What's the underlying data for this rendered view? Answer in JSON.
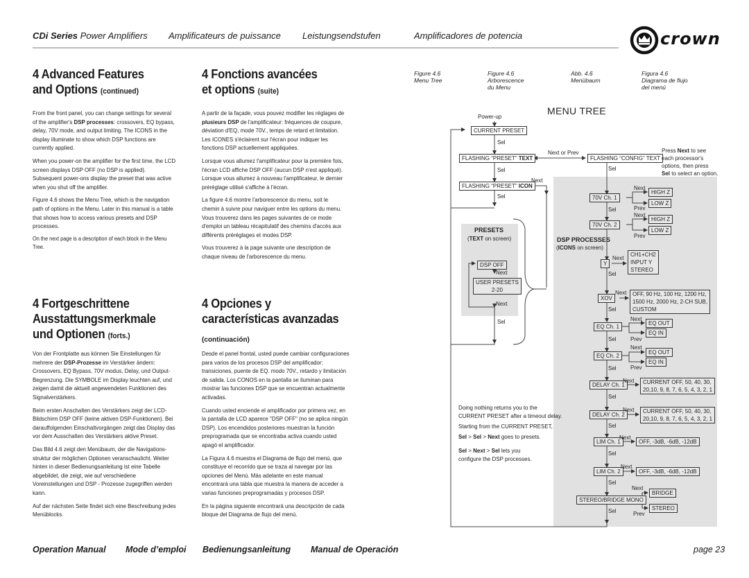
{
  "header": {
    "series_bold": "CDi Series",
    "series_rest": " Power Amplifiers",
    "fr": "Amplificateurs de puissance",
    "de": "Leistungsendstufen",
    "es": "Amplificadores de potencia",
    "brand": "crown",
    "logo_icon": "crown-logo-icon"
  },
  "sections": {
    "en": {
      "title_line1": "4 Advanced Features",
      "title_line2": "and Options",
      "title_suffix": "(continued)",
      "p1_a": "From the front panel, you can change settings for several of the amplifier's ",
      "p1_bold": "DSP processes",
      "p1_b": ": crossovers, EQ bypass, delay, 70V mode, and output limiting. The ICONS in the display illuminate to show which DSP functions are currently applied.",
      "p2": "When you power-on the amplifier for the first time, the LCD screen displays DSP OFF (no DSP is applied). Subsequent power-ons display the preset that was active when you shut off the amplifier.",
      "p3": "Figure 4.6 shows the Menu Tree, which is the navigation path of options in the Menu. Later in this manual is a table that shows how to access various presets and DSP processes.",
      "p4": "On the next page is a description of each block in the Menu Tree."
    },
    "fr": {
      "title_line1": "4 Fonctions avancées",
      "title_line2": "et options",
      "title_suffix": "(suite)",
      "p1_a": "A partir de la façade, vous pouvez modifier les réglages de ",
      "p1_bold": "plusieurs DSP",
      "p1_b": " de l'amplificateur: fréquences de coupure, déviation d'EQ, mode 70V., temps de retard et limitation. Les ICONES s'éclairent sur l'écran pour indiquer les fonctions DSP actuellement appliquées.",
      "p2": "Lorsque vous allumez l'amplificateur pour la première fois, l'écran LCD affiche DSP OFF (aucun DSP n'est appliqué). Lorsque vous allumez à nouveau l'amplificateur, le dernier préréglage utilisé s'affiche à l'écran.",
      "p3": "La figure 4.6 montre l'arborescence du menu, soit le chemin à suivre pour naviguer entre les options du menu. Vous trouverez dans les pages suivantes de ce mode d'emploi un tableau récapitulatif des chemins d'accès aux différents préréglages et modes DSP.",
      "p4": "Vous trouverez à la page suivante une description de chaque niveau de l'arborescence du menu."
    },
    "de": {
      "title_line1": "4 Fortgeschrittene",
      "title_line2": "Ausstattungsmerkmale",
      "title_line3": "und Optionen",
      "title_suffix": "(forts.)",
      "p1_a": "Von der Frontplatte aus können Sie Einstellungen für mehrere der ",
      "p1_bold": "DSP-Prozesse",
      "p1_b": " im Verstärker ändern: Crossovers, EQ Bypass, 70V modus, Delay, und Output-Begrenzung. Die SYMBOLE im Display leuchten auf, und zeigen damit die aktuell angewendeten Funktionen des Signalverstärkers.",
      "p2": "Beim ersten Anschalten des Verstärkers zeigt der LCD-Bildschirm DSP OFF (keine aktiven DSP-Funktionen). Bei darauffolgenden Einschaltvorgängen zeigt das Display das vor dem Ausschalten des Verstärkers aktive Preset.",
      "p3": "Das Bild 4.6 zeigt den Menübaum, der die Navigations-struktur der möglichen Optionen veranschaulicht. Weiter hinten in dieser Bedienungsanleitung ist eine Tabelle abgebildet, die zeigt, wie auf verschiedene Voreinstellungen und DSP - Prozesse zugegriffen werden kann.",
      "p4": "Auf der nächsten Seite findet sich eine Beschreibung jedes Menüblocks."
    },
    "es": {
      "title_line1": "4 Opciones y",
      "title_line2": "características avanzadas",
      "title_suffix": "(continuación)",
      "p1": "Desde el panel frontal, usted puede cambiar configuraciones para varios de los procesos DSP del amplificador: transiciones, puente de EQ. modo 70V., retardo y limitación de salida. Los CONOS en la pantalla se iluminan para mostrar las funciones DSP que se encuentran actualmente activadas.",
      "p2": "Cuando usted enciende el amplificador por primera vez, en la pantalla de LCD aparece \"DSP OFF\" (no se aplica ningún DSP). Los encendidos posteriores muestran la función preprogramada que se encontraba activa cuando usted apagó el amplificador.",
      "p3": "La Figura 4.6 muestra el Diagrama de flujo del menú, que constituye el recorrido que se traza al navegar por las opciones del Menú. Más adelante en este manual encontrará una tabla que muestra la manera de acceder a varias funciones preprogramadas y procesos DSP.",
      "p4": "En la página siguiente encontrará una descripción de cada bloque del Diagrama de flujo del menú."
    }
  },
  "figure_captions": [
    {
      "line1": "Figure 4.6",
      "line2": "Menu Tree",
      "line3": ""
    },
    {
      "line1": "Figure 4.6",
      "line2": "Arborescence",
      "line3": "du Menu"
    },
    {
      "line1": "Abb. 4.6",
      "line2": "Menübaum",
      "line3": ""
    },
    {
      "line1": "Figura 4.6",
      "line2": "Diagrama de flujo",
      "line3": "del menú"
    }
  ],
  "menu_tree": {
    "title": "MENU TREE",
    "power_up": "Power-up",
    "current_preset": "CURRENT PRESET",
    "flashing_preset_text_a": "FLASHING “PRESET” ",
    "flashing_preset_text_b": "TEXT",
    "flashing_preset_icon_a": "FLASHING “PRESET” ",
    "flashing_preset_icon_b": "ICON",
    "flashing_config": "FLASHING “CONFIG” TEXT",
    "next_or_prev": "Next or Prev",
    "sel": "Sel",
    "next": "Next",
    "prev": "Prev",
    "presets_title": "PRESETS",
    "presets_sub_bold": "TEXT",
    "presets_sub_rest": " on screen)",
    "dsp_off": "DSP OFF",
    "user_presets_1": "USER PRESETS",
    "user_presets_2": "2-20",
    "dsp_title": "DSP PROCESSES",
    "dsp_sub_bold": "ICONS",
    "dsp_sub_rest": " on screen)",
    "ch70v1": "70V Ch. 1",
    "ch70v2": "70V Ch. 2",
    "high_z": "HIGH Z",
    "low_z": "LOW Z",
    "y": "Y",
    "y_opts": [
      "CH1+CH2",
      "INPUT Y",
      "STEREO"
    ],
    "xov": "XOV",
    "xov_opts": [
      "OFF, 90 Hz, 100 Hz, 1200 Hz,",
      "1500 Hz, 2000 Hz, 2-CH SUB,",
      "CUSTOM"
    ],
    "eq1": "EQ Ch. 1",
    "eq2": "EQ Ch. 2",
    "eq_out": "EQ OUT",
    "eq_in": "EQ IN",
    "delay1": "DELAY Ch. 1",
    "delay2": "DELAY Ch. 2",
    "delay_opts": [
      "CURRENT OFF, 50, 40, 30,",
      "20,10, 9, 8, 7, 6, 5, 4, 3, 2, 1"
    ],
    "lim1": "LIM Ch. 1",
    "lim2": "LIM Ch. 2",
    "lim_opts": "OFF, -3dB, -6dB, -12dB",
    "stereo_bridge": "STEREO/BRIDGE MONO",
    "bridge": "BRIDGE",
    "stereo": "STEREO",
    "hint_a": "Press ",
    "hint_bold1": "Next",
    "hint_b": " to see",
    "hint_c": "each processor's",
    "hint_d": "options, then press",
    "hint_bold2": "Sel",
    "hint_e": " to select an option.",
    "note1": "Doing nothing returns you to the",
    "note2": "CURRENT PRESET after a timeout delay.",
    "note3": "Starting from the CURRENT PRESET,",
    "note4_b1": "Sel",
    "note4_b2": "Sel",
    "note4_b3": "Next",
    "note4_rest": " goes to presets.",
    "note5_b1": "Sel",
    "note5_b2": "Next",
    "note5_b3": "Sel",
    "note5_rest": " lets you",
    "note6": "configure the DSP processes.",
    "gt": " > "
  },
  "footer": {
    "en": "Operation Manual",
    "fr": "Mode d’emploi",
    "de": "Bedienungsanleitung",
    "es": "Manual de Operación",
    "page": "page 23"
  }
}
